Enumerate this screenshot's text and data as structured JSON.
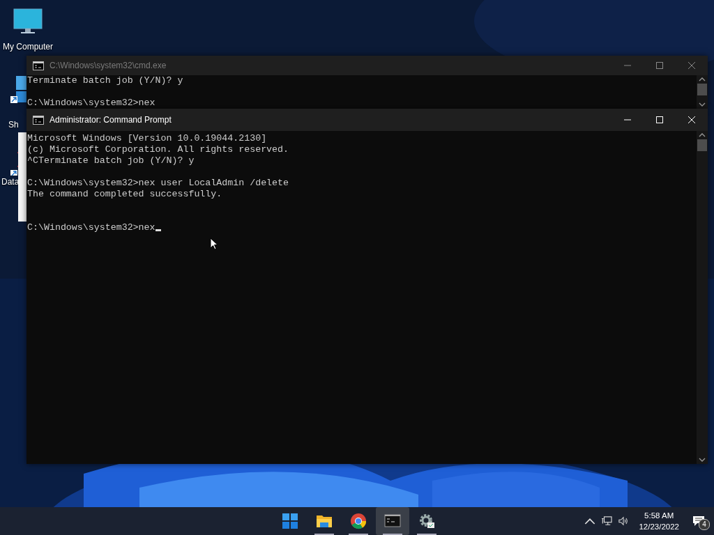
{
  "desktop": {
    "icons": [
      {
        "kind": "monitor",
        "label": "My Computer"
      },
      {
        "kind": "shortcut",
        "label": "Sh"
      },
      {
        "kind": "shortcut-x",
        "label": "Data"
      }
    ]
  },
  "windows": [
    {
      "title": "C:\\Windows\\system32\\cmd.exe",
      "active": false,
      "text": "Terminate batch job (Y/N)? y\n\nC:\\Windows\\system32>nex",
      "cursor": false
    },
    {
      "title": "Administrator: Command Prompt",
      "active": true,
      "text": "Microsoft Windows [Version 10.0.19044.2130]\n(c) Microsoft Corporation. All rights reserved.\n^CTerminate batch job (Y/N)? y\n\nC:\\Windows\\system32>nex user LocalAdmin /delete\nThe command completed successfully.\n\n\nC:\\Windows\\system32>nex",
      "cursor": true
    }
  ],
  "taskbar": {
    "apps": [
      {
        "kind": "start",
        "running": false,
        "selected": false
      },
      {
        "kind": "folder",
        "running": true,
        "selected": false
      },
      {
        "kind": "browser",
        "running": true,
        "selected": false
      },
      {
        "kind": "terminal",
        "running": true,
        "selected": true
      },
      {
        "kind": "settings",
        "running": true,
        "selected": false
      }
    ],
    "tray": {
      "time": "5:58 AM",
      "date": "12/23/2022",
      "notifications": "4"
    }
  }
}
